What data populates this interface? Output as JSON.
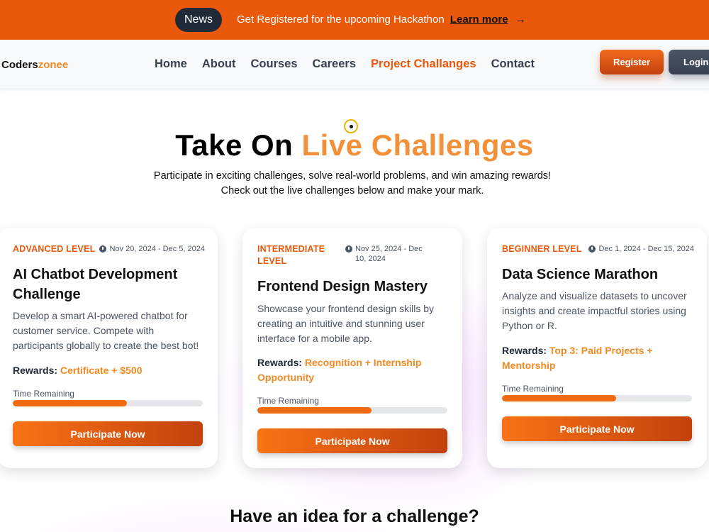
{
  "announcement": {
    "badge": "News",
    "text": "Get Registered for the upcoming Hackathon",
    "link": "Learn more",
    "arrow": "→"
  },
  "header": {
    "logo_main": "Coders",
    "logo_accent": "zonee",
    "nav": [
      "Home",
      "About",
      "Courses",
      "Careers",
      "Project Challanges",
      "Contact"
    ],
    "active_nav": "Project Challanges",
    "register": "Register",
    "login": "Login"
  },
  "hero": {
    "title_plain": "Take On",
    "title_highlight": "Live Challenges",
    "subtitle": "Participate in exciting challenges, solve real-world problems, and win amazing rewards! Check out the live challenges below and make your mark."
  },
  "cards": [
    {
      "level": "ADVANCED LEVEL",
      "dates": "Nov 20, 2024 - Dec 5, 2024",
      "title": "AI Chatbot Development Challenge",
      "description": "Develop a smart AI-powered chatbot for customer service. Compete with participants globally to create the best bot!",
      "rewards_label": "Rewards:",
      "rewards_value": "Certificate + $500",
      "time_label": "Time Remaining",
      "progress": 0.6,
      "button": "Participate Now"
    },
    {
      "level": "INTERMEDIATE LEVEL",
      "dates": "Nov 25, 2024 - Dec 10, 2024",
      "title": "Frontend Design Mastery",
      "description": "Showcase your frontend design skills by creating an intuitive and stunning user interface for a mobile app.",
      "rewards_label": "Rewards:",
      "rewards_value": "Recognition + Internship Opportunity",
      "time_label": "Time Remaining",
      "progress": 0.6,
      "button": "Participate Now"
    },
    {
      "level": "BEGINNER LEVEL",
      "dates": "Dec 1, 2024 - Dec 15, 2024",
      "title": "Data Science Marathon",
      "description": "Analyze and visualize datasets to uncover insights and create impactful stories using Python or R.",
      "rewards_label": "Rewards:",
      "rewards_value": "Top 3: Paid Projects + Mentorship",
      "time_label": "Time Remaining",
      "progress": 0.6,
      "button": "Participate Now"
    }
  ],
  "section_title": "Have an idea for a challenge?",
  "colors": {
    "accent": "#ea580c",
    "accent_light": "#f08a24",
    "dark": "#1f2937"
  }
}
